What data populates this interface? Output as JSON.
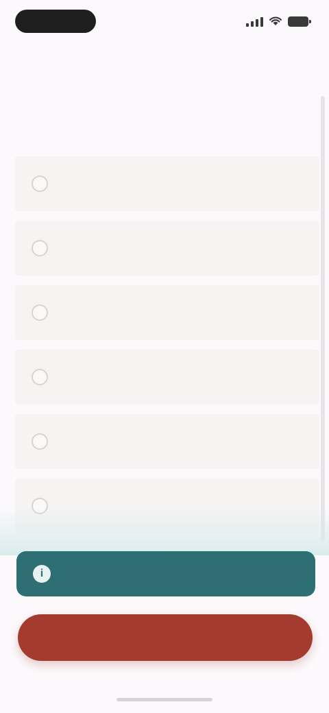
{
  "status_bar": {
    "time": "",
    "icons": [
      "signal-icon",
      "wifi-icon",
      "battery-icon"
    ]
  },
  "question": {
    "text": ""
  },
  "options": [
    {
      "label": ""
    },
    {
      "label": ""
    },
    {
      "label": ""
    },
    {
      "label": ""
    },
    {
      "label": ""
    },
    {
      "label": ""
    }
  ],
  "skip_bar": {
    "icon": "info-icon",
    "label": ""
  },
  "primary_button": {
    "label": ""
  },
  "colors": {
    "teal": "#2d6f72",
    "brand_red": "#a33b2e",
    "background": "#fcf9fc",
    "option_bg": "#f6f3f3"
  }
}
